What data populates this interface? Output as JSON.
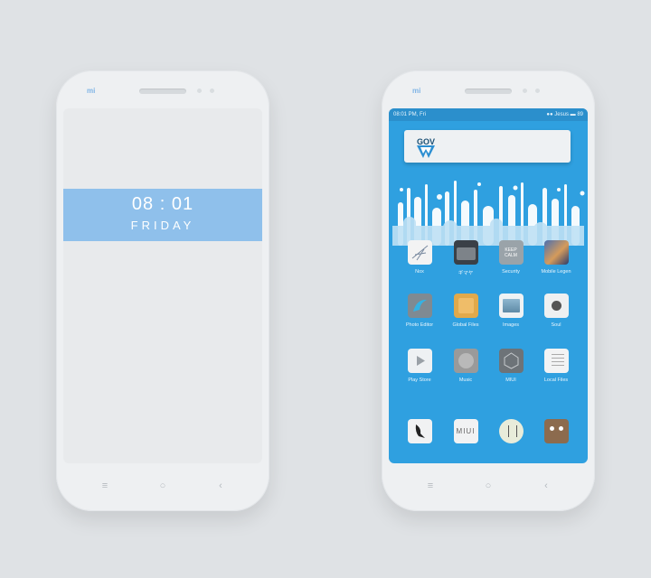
{
  "left_phone": {
    "brand": "mi",
    "lock": {
      "time": "08 : 01",
      "day": "FRIDAY"
    },
    "nav": {
      "menu": "≡",
      "home": "○",
      "back": "‹"
    }
  },
  "right_phone": {
    "brand": "mi",
    "status": {
      "left": "08:01 PM, Fri",
      "right": "●● Jesus ▬ 89"
    },
    "widget": {
      "title": "GOV"
    },
    "apps": [
      {
        "label": "Nox",
        "icon": "nox-icon"
      },
      {
        "label": "ギマヤ",
        "icon": "folder-icon"
      },
      {
        "label": "Security",
        "icon": "keep-calm-icon",
        "text": "KEEP CALM"
      },
      {
        "label": "Mobile Legen",
        "icon": "game-icon"
      },
      {
        "label": "Photo Editor",
        "icon": "photo-editor-icon"
      },
      {
        "label": "Global Files",
        "icon": "folder-icon"
      },
      {
        "label": "Images",
        "icon": "image-icon"
      },
      {
        "label": "Soul",
        "icon": "soul-icon"
      },
      {
        "label": "Play Store",
        "icon": "play-icon"
      },
      {
        "label": "Music",
        "icon": "music-icon"
      },
      {
        "label": "MIUI",
        "icon": "miui-icon"
      },
      {
        "label": "Local Files",
        "icon": "notes-icon"
      }
    ],
    "dock": [
      {
        "icon": "bird-icon"
      },
      {
        "icon": "miui-text-icon",
        "text": "MIUI"
      },
      {
        "icon": "quote-icon"
      },
      {
        "icon": "animal-icon"
      }
    ],
    "nav": {
      "menu": "≡",
      "home": "○",
      "back": "‹"
    }
  }
}
